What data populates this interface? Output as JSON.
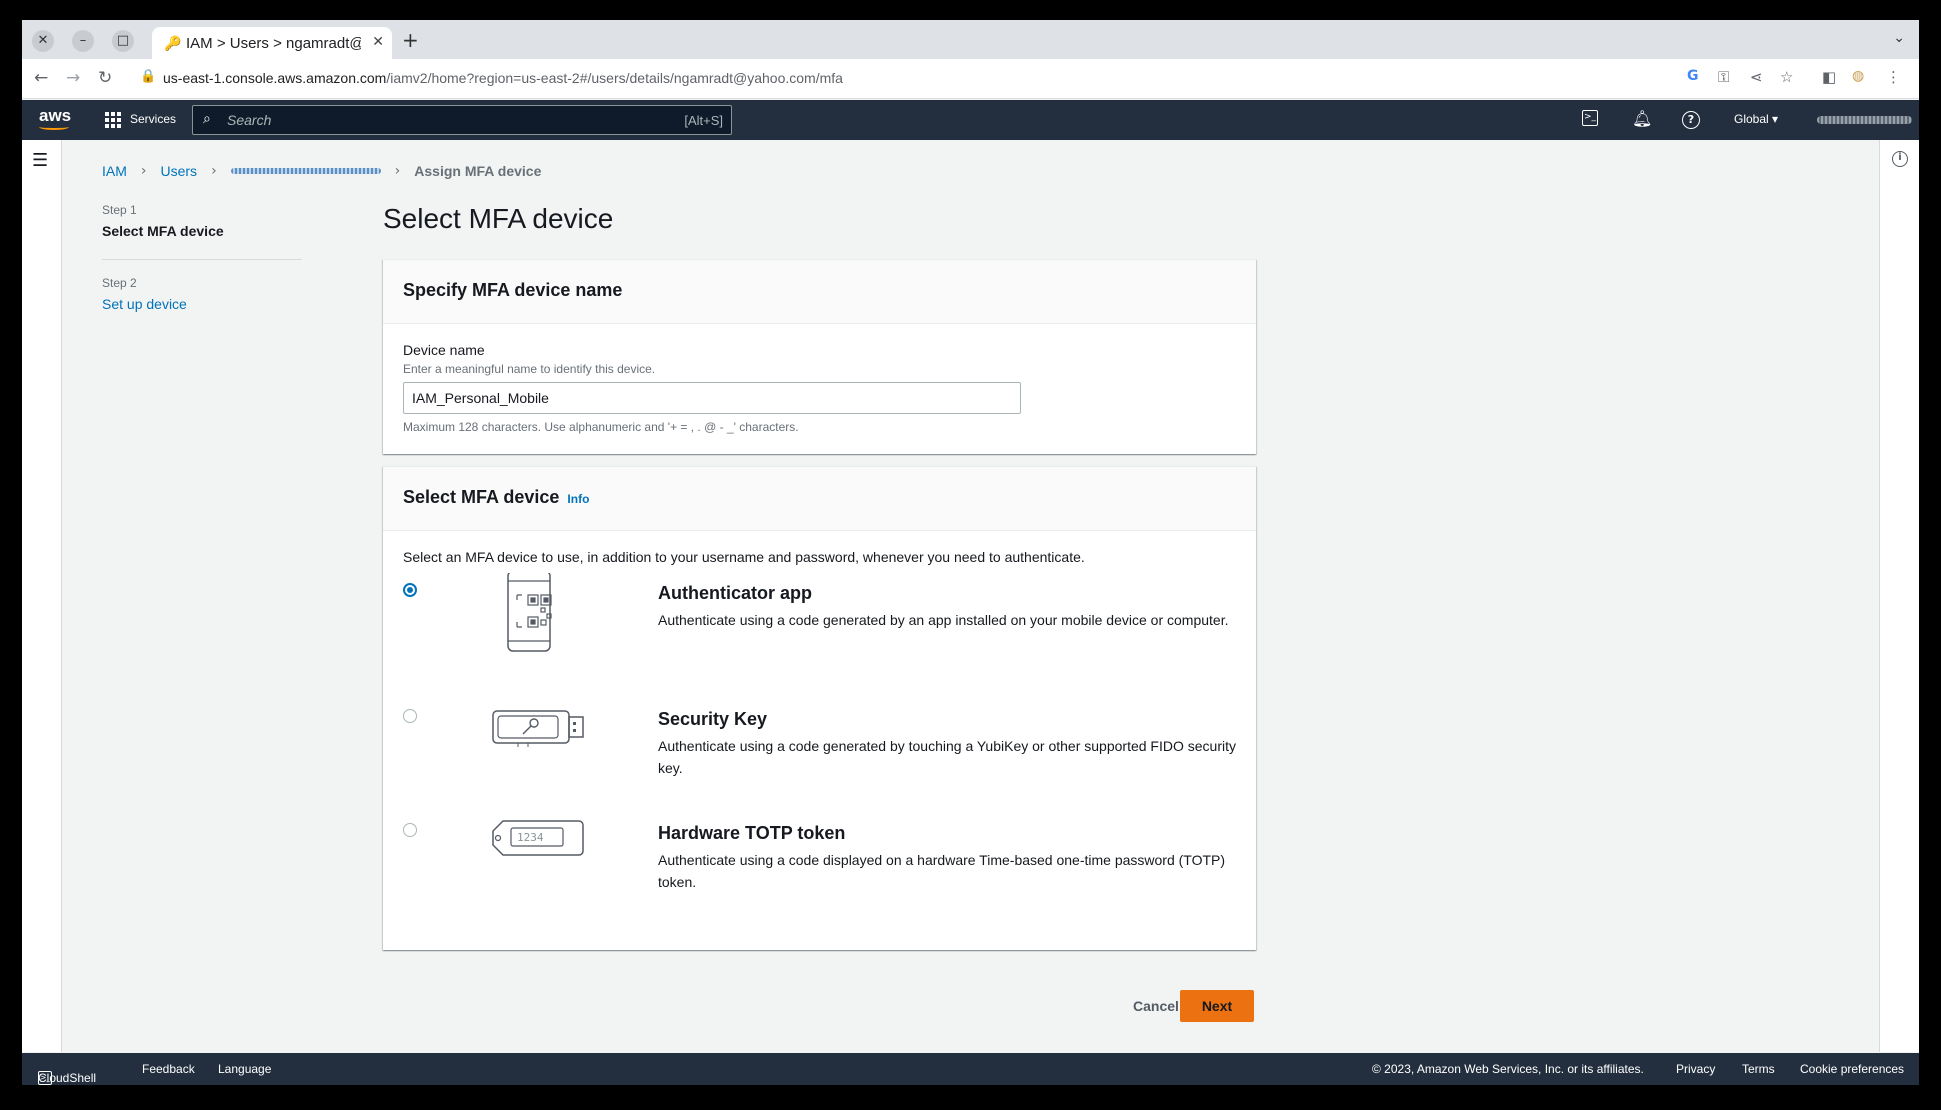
{
  "browser": {
    "tab_title": "IAM > Users > ngamradt@yahoo.com",
    "url_host": "us-east-1.console.aws.amazon.com",
    "url_path": "/iamv2/home?region=us-east-2#/users/details/ngamradt@yahoo.com/mfa"
  },
  "awsnav": {
    "logo": "aws",
    "services_label": "Services",
    "search_placeholder": "Search",
    "search_hint": "[Alt+S]",
    "region": "Global ▾"
  },
  "breadcrumb": {
    "iam": "IAM",
    "users": "Users",
    "current": "Assign MFA device"
  },
  "steps": [
    {
      "num": "Step 1",
      "title": "Select MFA device"
    },
    {
      "num": "Step 2",
      "title": "Set up device"
    }
  ],
  "page_title": "Select MFA device",
  "name_panel": {
    "header": "Specify MFA device name",
    "label": "Device name",
    "description": "Enter a meaningful name to identify this device.",
    "value": "IAM_Personal_Mobile",
    "constraint": "Maximum 128 characters. Use alphanumeric and '+ = , . @ - _' characters."
  },
  "device_panel": {
    "header": "Select MFA device",
    "info": "Info",
    "intro": "Select an MFA device to use, in addition to your username and password, whenever you need to authenticate.",
    "options": [
      {
        "title": "Authenticator app",
        "desc": "Authenticate using a code generated by an app installed on your mobile device or computer.",
        "selected": true
      },
      {
        "title": "Security Key",
        "desc": "Authenticate using a code generated by touching a YubiKey or other supported FIDO security key.",
        "selected": false
      },
      {
        "title": "Hardware TOTP token",
        "desc": "Authenticate using a code displayed on a hardware Time-based one-time password (TOTP) token.",
        "selected": false
      }
    ],
    "token_display": "1234"
  },
  "actions": {
    "cancel": "Cancel",
    "next": "Next"
  },
  "footer": {
    "cloudshell": "CloudShell",
    "feedback": "Feedback",
    "language": "Language",
    "copyright": "© 2023, Amazon Web Services, Inc. or its affiliates.",
    "privacy": "Privacy",
    "terms": "Terms",
    "cookies": "Cookie preferences"
  },
  "colors": {
    "aws_nav": "#232f3e",
    "link": "#0073bb",
    "primary_button": "#ec7211"
  }
}
